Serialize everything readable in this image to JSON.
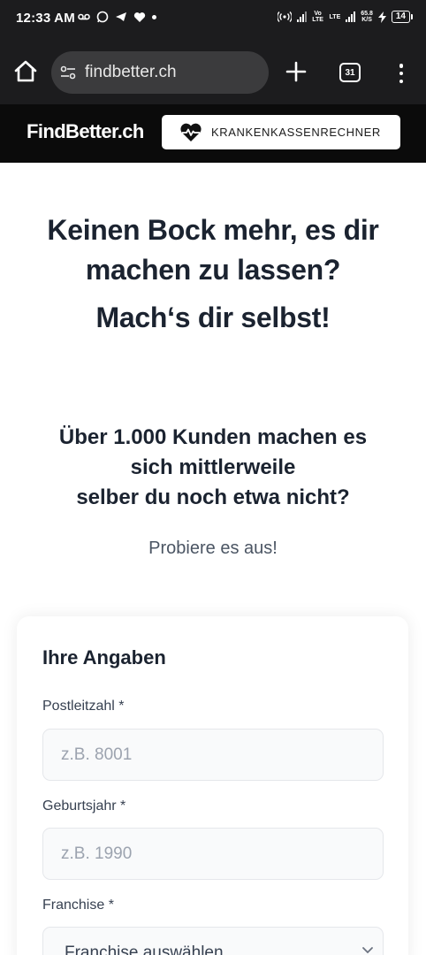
{
  "status_bar": {
    "time": "12:33 AM",
    "left_icons": [
      "voicemail-icon",
      "whatsapp-icon",
      "telegram-icon",
      "heart-app-icon",
      "dot-icon"
    ],
    "network_label_1": "Vo LTE",
    "network_label_2": "LTE",
    "speed_value": "65.8",
    "speed_unit": "K/S",
    "battery": "14"
  },
  "browser": {
    "url": "findbetter.ch",
    "tab_count": "31"
  },
  "header": {
    "logo": "FindBetter.ch",
    "calculator_button": "KRANKENKASSENRECHNER"
  },
  "hero": {
    "title_line1": "Keinen Bock mehr, es dir",
    "title_line2": "machen zu lassen?",
    "subtitle": "Mach‘s dir selbst!"
  },
  "stats": {
    "line1": "Über 1.000 Kunden machen es",
    "line2": "sich mittlerweile",
    "line3": "selber du noch etwa nicht?"
  },
  "try_it": "Probiere es aus!",
  "form": {
    "title": "Ihre Angaben",
    "postal_code": {
      "label": "Postleitzahl *",
      "placeholder": "z.B. 8001",
      "value": ""
    },
    "birth_year": {
      "label": "Geburtsjahr *",
      "placeholder": "z.B. 1990",
      "value": ""
    },
    "franchise": {
      "label": "Franchise *",
      "selected": "Franchise auswählen"
    }
  },
  "colors": {
    "status_bg": "#1c1c1e",
    "header_bg": "#0b0b0b",
    "text_dark": "#1b2330",
    "input_bg": "#f9fafb"
  }
}
